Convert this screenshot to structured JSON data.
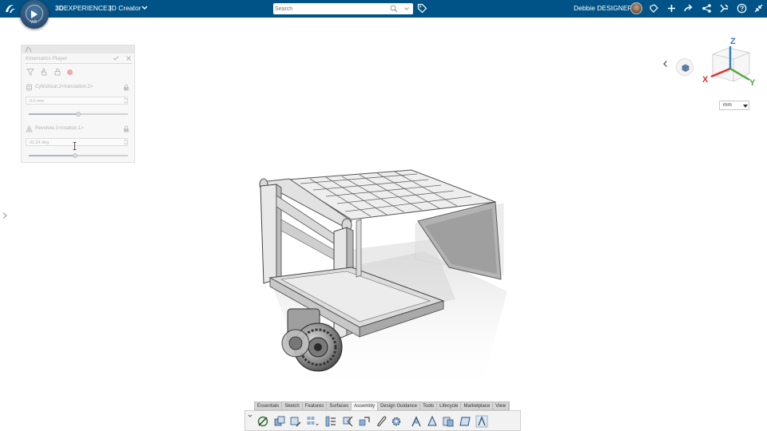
{
  "topbar": {
    "brand_bold": "3D",
    "brand_rest": "EXPERIENCE",
    "separator": "|",
    "app_name": "3D Creator",
    "search_placeholder": "Search",
    "user_name": "Debbie DESIGNER",
    "compass_version": "V.R"
  },
  "kinematics_panel": {
    "title": "Kinematics Player",
    "joints": [
      {
        "name": "Cylindrical.2<translation.2>",
        "value": "-3.6 mm",
        "slider_fraction": 0.5
      },
      {
        "name": "Revolute.1<rotation.1>",
        "value": "-32.24 deg",
        "slider_fraction": 0.47
      }
    ]
  },
  "view": {
    "axis_x": "X",
    "axis_y": "Y",
    "axis_z": "Z",
    "unit": "mm",
    "colors": {
      "x": "#e0312b",
      "y": "#4aa83a",
      "z": "#2f7fbf"
    }
  },
  "action_bar": {
    "tabs": [
      "Essentials",
      "Sketch",
      "Features",
      "Surfaces",
      "Assembly",
      "Design Guidance",
      "Tools",
      "Lifecycle",
      "Marketplace",
      "View"
    ],
    "active_tab": "Assembly"
  },
  "colors": {
    "topbar": "#005386",
    "accent": "#005386"
  }
}
